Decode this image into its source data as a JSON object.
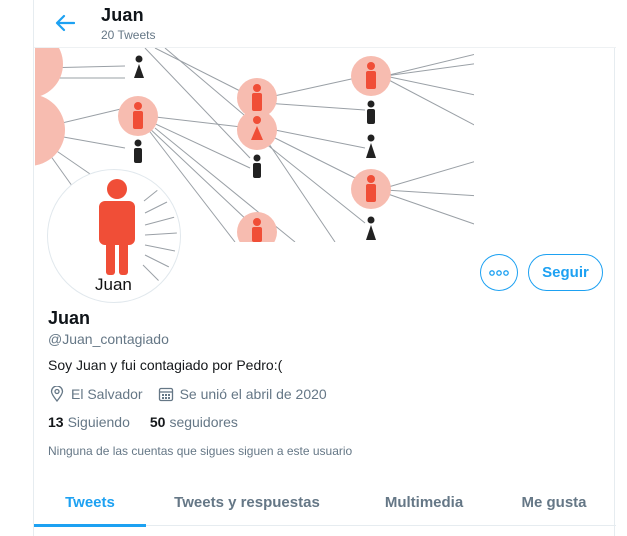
{
  "header": {
    "name": "Juan",
    "tweet_count": "20 Tweets"
  },
  "avatar": {
    "label": "Juan"
  },
  "actions": {
    "follow_label": "Seguir"
  },
  "profile": {
    "name": "Juan",
    "handle": "@Juan_contagiado",
    "bio": "Soy Juan y fui contagiado por Pedro:(",
    "location": "El Salvador",
    "joined": "Se unió el abril de 2020",
    "following_count": "13",
    "following_label": "Siguiendo",
    "followers_count": "50",
    "followers_label": "seguidores",
    "followers_notice": "Ninguna de las cuentas que sigues siguen a este usuario"
  },
  "tabs": [
    {
      "label": "Tweets",
      "active": true
    },
    {
      "label": "Tweets y respuestas",
      "active": false
    },
    {
      "label": "Multimedia",
      "active": false
    },
    {
      "label": "Me gusta",
      "active": false
    }
  ],
  "colors": {
    "accent": "#1da1f2",
    "infected": "#f04e37",
    "infected_halo": "#f7bcb0",
    "healthy": "#222222"
  }
}
